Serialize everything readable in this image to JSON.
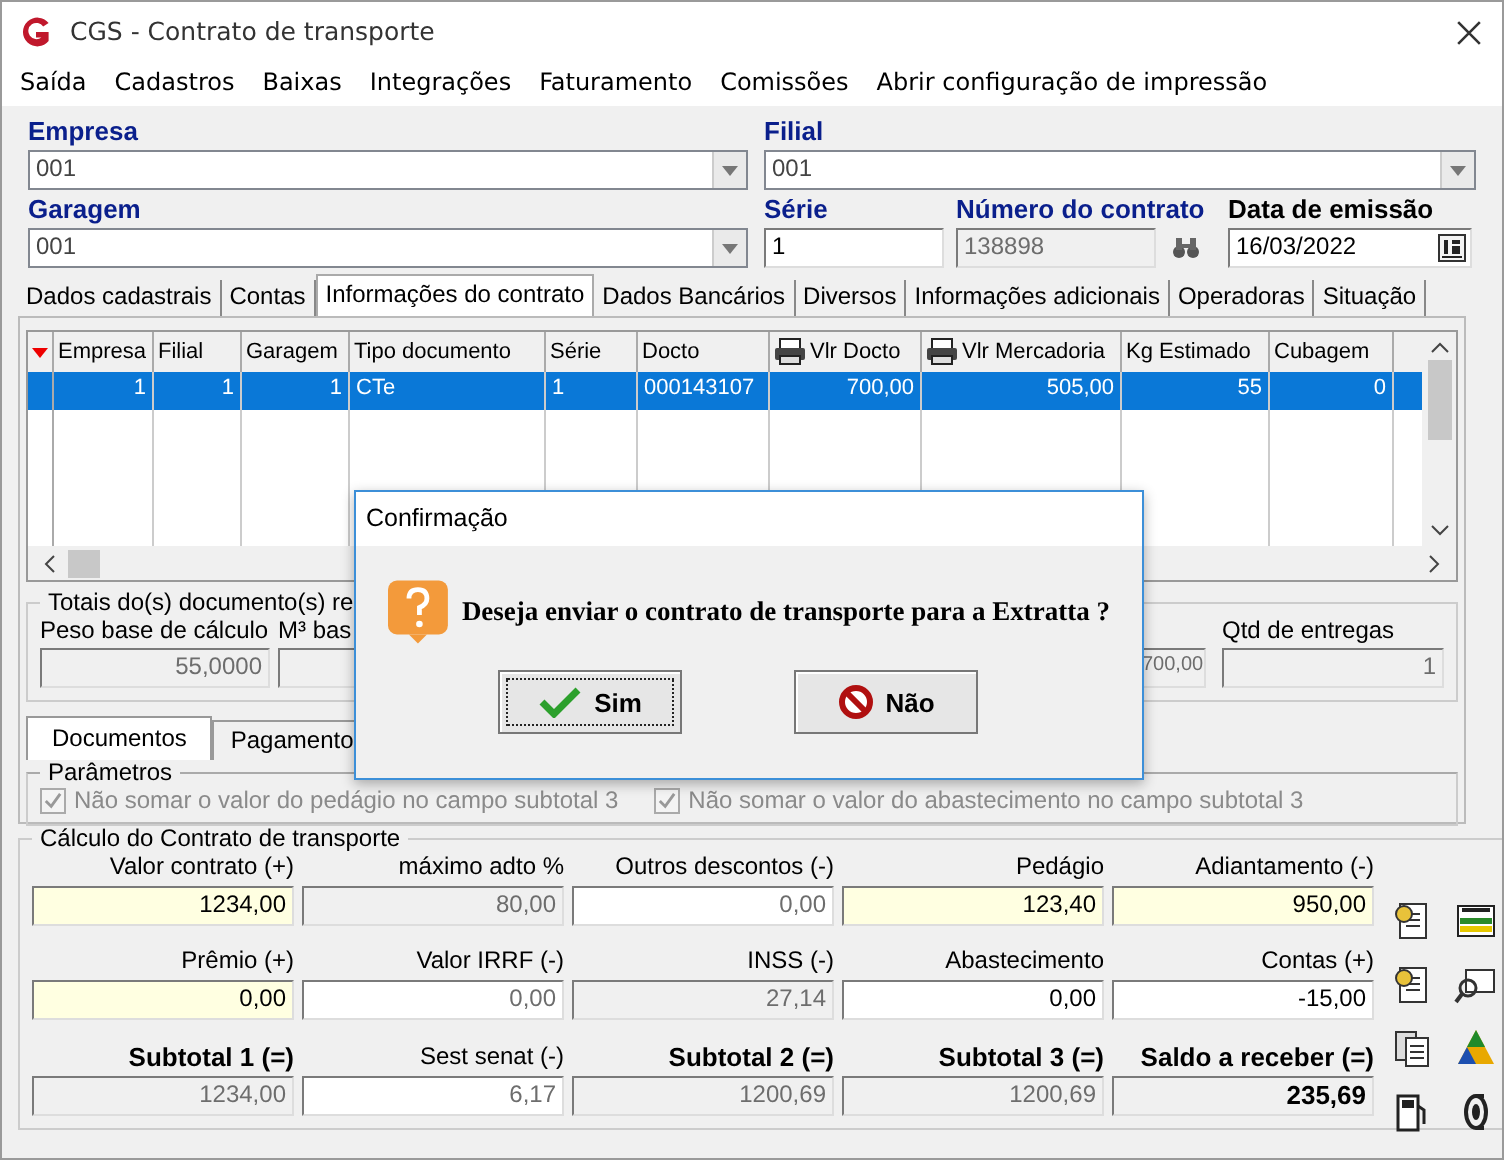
{
  "window": {
    "title": "CGS - Contrato de transporte"
  },
  "menu": [
    "Saída",
    "Cadastros",
    "Baixas",
    "Integrações",
    "Faturamento",
    "Comissões",
    "Abrir configuração de impressão"
  ],
  "header": {
    "empresa": {
      "label": "Empresa",
      "value": "001"
    },
    "filial": {
      "label": "Filial",
      "value": "001"
    },
    "garagem": {
      "label": "Garagem",
      "value": "001"
    },
    "serie": {
      "label": "Série",
      "value": "1"
    },
    "numero": {
      "label": "Número do contrato",
      "value": "138898"
    },
    "data": {
      "label": "Data de emissão",
      "value": "16/03/2022"
    }
  },
  "tabs": [
    {
      "label": "Dados cadastrais",
      "selected": false
    },
    {
      "label": "Contas",
      "selected": false
    },
    {
      "label": "Informações do contrato",
      "selected": true
    },
    {
      "label": "Dados Bancários",
      "selected": false
    },
    {
      "label": "Diversos",
      "selected": false
    },
    {
      "label": "Informações adicionais",
      "selected": false
    },
    {
      "label": "Operadoras",
      "selected": false
    },
    {
      "label": "Situação",
      "selected": false
    }
  ],
  "grid": {
    "columns": [
      {
        "label": "Empresa",
        "printer": false
      },
      {
        "label": "Filial",
        "printer": false
      },
      {
        "label": "Garagem",
        "printer": false
      },
      {
        "label": "Tipo documento",
        "printer": false
      },
      {
        "label": "Série",
        "printer": false
      },
      {
        "label": "Docto",
        "printer": false
      },
      {
        "label": "Vlr Docto",
        "printer": true
      },
      {
        "label": "Vlr Mercadoria",
        "printer": true
      },
      {
        "label": "Kg Estimado",
        "printer": false
      },
      {
        "label": "Cubagem",
        "printer": false
      }
    ],
    "rows": [
      {
        "selected": true,
        "cells": [
          "1",
          "1",
          "1",
          "CTe",
          "1",
          "000143107",
          "700,00",
          "505,00",
          "55",
          "0"
        ]
      }
    ]
  },
  "totals": {
    "legend": "Totais do(s) documento(s) re",
    "peso": {
      "label": "Peso base de cálculo",
      "value": "55,0000"
    },
    "m3": {
      "label": "M³ bas"
    },
    "valor": {
      "value": "700,00"
    },
    "qtd": {
      "label": "Qtd de entregas",
      "value": "1"
    }
  },
  "subtabs": [
    {
      "label": "Documentos",
      "selected": true
    },
    {
      "label": "Pagamento",
      "selected": false
    }
  ],
  "parametros": {
    "legend": "Parâmetros",
    "checks": [
      {
        "label": "Não somar o valor do pedágio no campo subtotal 3",
        "checked": true,
        "disabled": true
      },
      {
        "label": "Não somar o valor do abastecimento no campo subtotal 3",
        "checked": true,
        "disabled": true
      }
    ]
  },
  "calculo": {
    "legend": "Cálculo do Contrato de transporte",
    "fields": [
      {
        "label": "Valor contrato (+)",
        "value": "1234,00",
        "highlighted": true,
        "read_only": false,
        "dimmed": false,
        "bold": false
      },
      {
        "label": "máximo adto %",
        "value": "80,00",
        "highlighted": false,
        "read_only": true,
        "dimmed": true,
        "bold": false
      },
      {
        "label": "Outros descontos (-)",
        "value": "0,00",
        "highlighted": false,
        "read_only": false,
        "dimmed": true,
        "bold": false
      },
      {
        "label": "Pedágio",
        "value": "123,40",
        "highlighted": true,
        "read_only": false,
        "dimmed": false,
        "bold": false
      },
      {
        "label": "Adiantamento (-)",
        "value": "950,00",
        "highlighted": true,
        "read_only": false,
        "dimmed": false,
        "bold": false
      },
      {
        "label": "Prêmio (+)",
        "value": "0,00",
        "highlighted": true,
        "read_only": false,
        "dimmed": false,
        "bold": false
      },
      {
        "label": "Valor IRRF (-)",
        "value": "0,00",
        "highlighted": false,
        "read_only": false,
        "dimmed": true,
        "bold": false
      },
      {
        "label": "INSS (-)",
        "value": "27,14",
        "highlighted": false,
        "read_only": true,
        "dimmed": true,
        "bold": false
      },
      {
        "label": "Abastecimento",
        "value": "0,00",
        "highlighted": false,
        "read_only": false,
        "dimmed": false,
        "bold": false
      },
      {
        "label": "Contas (+)",
        "value": "-15,00",
        "highlighted": false,
        "read_only": false,
        "dimmed": false,
        "bold": false
      },
      {
        "label": "Subtotal 1 (=)",
        "value": "1234,00",
        "highlighted": false,
        "read_only": true,
        "dimmed": true,
        "bold": true
      },
      {
        "label": "Sest senat (-)",
        "value": "6,17",
        "highlighted": false,
        "read_only": false,
        "dimmed": true,
        "bold": false
      },
      {
        "label": "Subtotal 2 (=)",
        "value": "1200,69",
        "highlighted": false,
        "read_only": true,
        "dimmed": true,
        "bold": true
      },
      {
        "label": "Subtotal 3 (=)",
        "value": "1200,69",
        "highlighted": false,
        "read_only": true,
        "dimmed": true,
        "bold": true
      },
      {
        "label": "Saldo a receber (=)",
        "value": "235,69",
        "highlighted": false,
        "read_only": true,
        "dimmed": false,
        "bold": true
      }
    ]
  },
  "dialog": {
    "title": "Confirmação",
    "message": "Deseja enviar o contrato de transporte para a Extratta ?",
    "buttons": [
      {
        "label": "Sim",
        "kind": "yes"
      },
      {
        "label": "Não",
        "kind": "no"
      }
    ]
  }
}
